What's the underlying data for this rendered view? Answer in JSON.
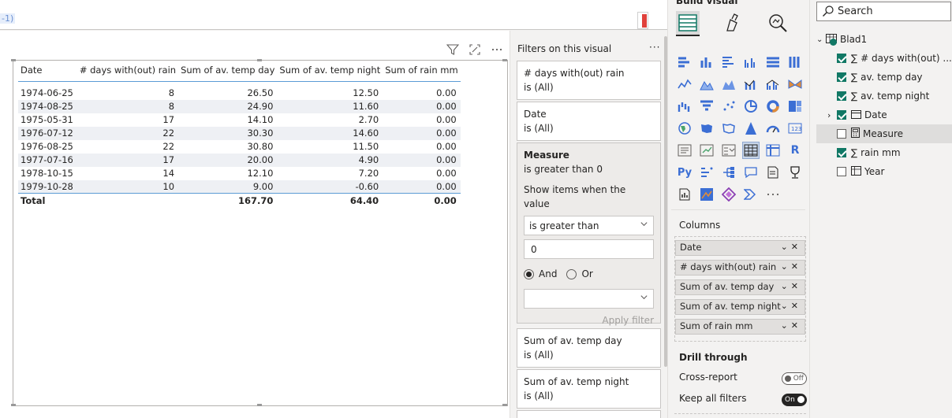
{
  "formula": {
    "text": "-1)"
  },
  "table": {
    "headers": [
      "Date",
      "# days with(out) rain",
      "Sum of av. temp day",
      "Sum of av. temp night",
      "Sum of rain mm"
    ],
    "rows": [
      [
        "1974-06-25",
        "8",
        "26.50",
        "12.50",
        "0.00"
      ],
      [
        "1974-08-25",
        "8",
        "24.90",
        "11.60",
        "0.00"
      ],
      [
        "1975-05-31",
        "17",
        "14.10",
        "2.70",
        "0.00"
      ],
      [
        "1976-07-12",
        "22",
        "30.30",
        "14.60",
        "0.00"
      ],
      [
        "1976-08-25",
        "22",
        "30.80",
        "11.50",
        "0.00"
      ],
      [
        "1977-07-16",
        "17",
        "20.00",
        "4.90",
        "0.00"
      ],
      [
        "1978-10-15",
        "14",
        "12.10",
        "7.20",
        "0.00"
      ],
      [
        "1979-10-28",
        "10",
        "9.00",
        "-0.60",
        "0.00"
      ]
    ],
    "total": [
      "Total",
      "",
      "167.70",
      "64.40",
      "0.00"
    ]
  },
  "filters": {
    "title": "Filters on this visual",
    "more": "···",
    "cards": [
      {
        "name": "# days with(out) rain",
        "state": "is (All)"
      },
      {
        "name": "Date",
        "state": "is (All)"
      }
    ],
    "measure": {
      "name": "Measure",
      "state": "is greater than 0",
      "show_label": "Show items when the value",
      "condition": "is greater than",
      "value": "0",
      "and_label": "And",
      "or_label": "Or",
      "second_condition": "",
      "apply_label": "Apply filter"
    },
    "cards2": [
      {
        "name": "Sum of av. temp day",
        "state": "is (All)"
      },
      {
        "name": "Sum of av. temp night",
        "state": "is (All)"
      }
    ]
  },
  "viz": {
    "heading": "Build visual",
    "columns_label": "Columns",
    "wells": [
      "Date",
      "# days with(out) rain",
      "Sum of av. temp day",
      "Sum of av. temp night",
      "Sum of rain mm"
    ],
    "drill_label": "Drill through",
    "cross_report_label": "Cross-report",
    "cross_report_state": "Off",
    "keep_filters_label": "Keep all filters",
    "keep_filters_state": "On"
  },
  "data": {
    "search_placeholder": "Search",
    "table_name": "Blad1",
    "fields": [
      {
        "label": "# days with(out) ...",
        "checked": true,
        "type": "sigma"
      },
      {
        "label": "av. temp day",
        "checked": true,
        "type": "sigma"
      },
      {
        "label": "av. temp night",
        "checked": true,
        "type": "sigma"
      },
      {
        "label": "Date",
        "checked": true,
        "type": "calendar"
      },
      {
        "label": "Measure",
        "checked": false,
        "type": "calc"
      },
      {
        "label": "rain mm",
        "checked": true,
        "type": "sigma"
      },
      {
        "label": "Year",
        "checked": false,
        "type": "table"
      }
    ]
  },
  "colors": {
    "accent": "#117865",
    "table_rule": "#5b9bd5",
    "row_shade": "#eef0f4"
  }
}
